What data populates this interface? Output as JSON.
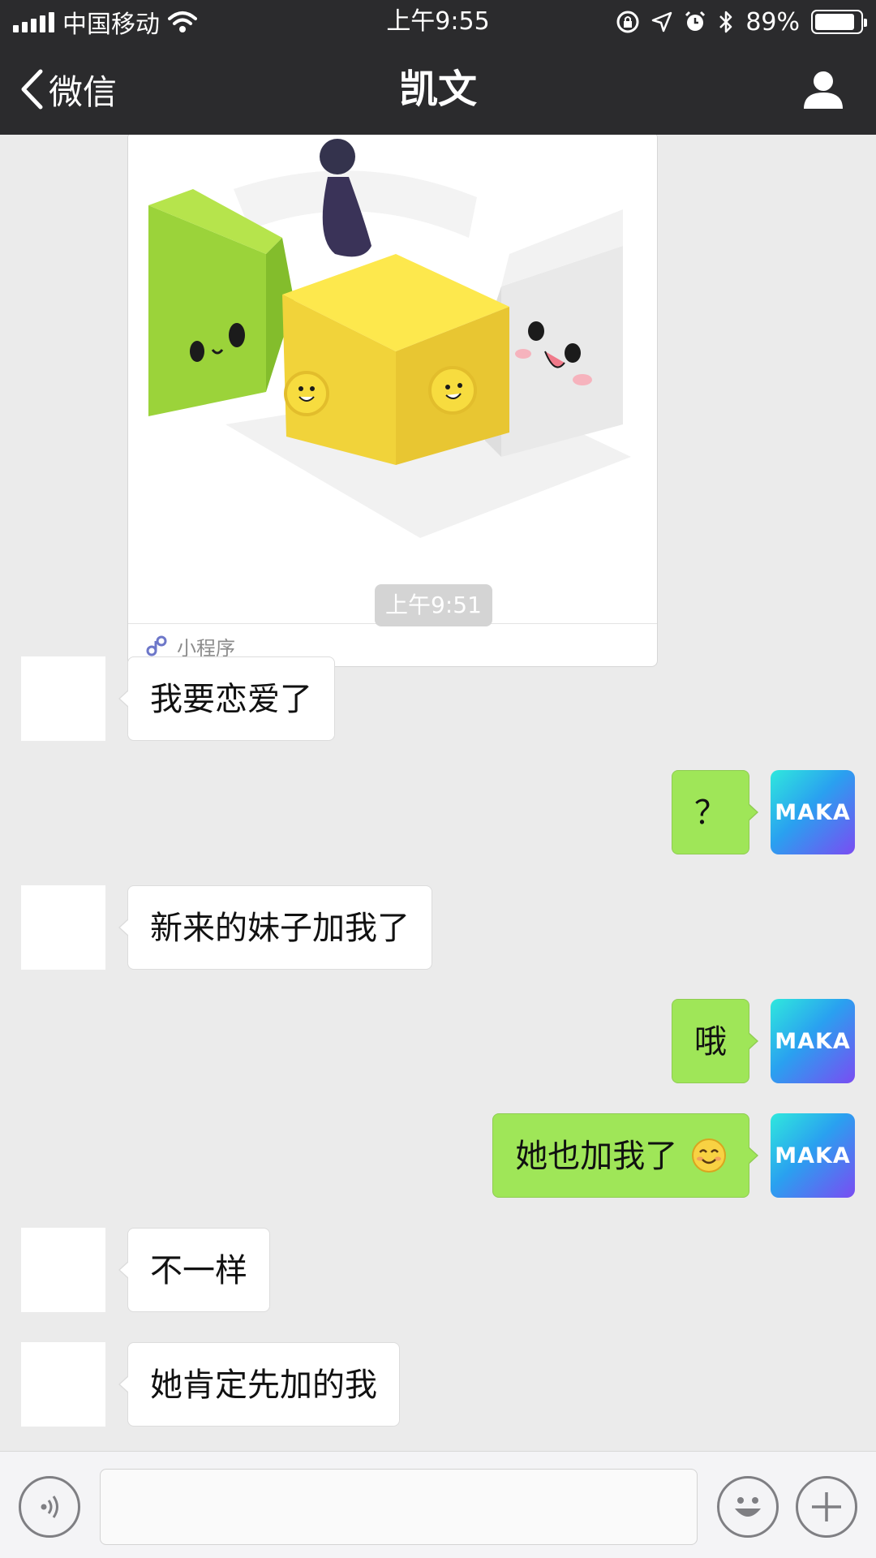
{
  "status_bar": {
    "carrier": "中国移动",
    "time": "上午9:55",
    "battery": "89%",
    "battery_level": 0.89
  },
  "nav": {
    "back_label": "微信",
    "title": "凯文"
  },
  "mini_program": {
    "label": "小程序"
  },
  "timestamp": "上午9:51",
  "messages": [
    {
      "side": "left",
      "text": "我要恋爱了"
    },
    {
      "side": "right",
      "text": "？",
      "avatar": "MAKA"
    },
    {
      "side": "left",
      "text": "新来的妹子加我了"
    },
    {
      "side": "right",
      "text": "哦",
      "avatar": "MAKA"
    },
    {
      "side": "right",
      "text": "她也加我了",
      "emoji": "smiley-emoji",
      "avatar": "MAKA"
    },
    {
      "side": "left",
      "text": "不一样"
    },
    {
      "side": "left",
      "text": "她肯定先加的我"
    }
  ],
  "colors": {
    "header_bg": "#2b2b2d",
    "chat_bg": "#ebebeb",
    "sent_bubble": "#9fe658",
    "received_bubble": "#ffffff"
  },
  "icons": [
    "signal-icon",
    "wifi-icon",
    "lock-rotation-icon",
    "location-icon",
    "alarm-icon",
    "bluetooth-icon",
    "battery-icon",
    "back-chevron-icon",
    "profile-icon",
    "mini-program-icon",
    "voice-icon",
    "emoji-icon",
    "plus-icon"
  ]
}
